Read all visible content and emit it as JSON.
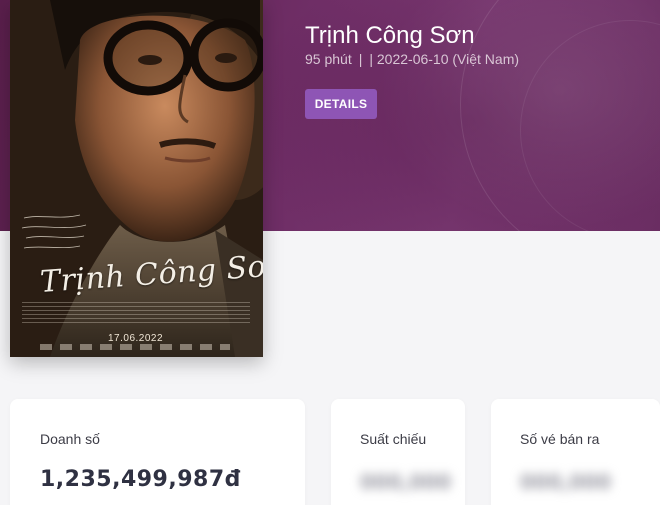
{
  "movie": {
    "title": "Trịnh Công Sơn",
    "duration": "95 phút",
    "separator": "|",
    "release": "| 2022-06-10 (Việt Nam)",
    "details_label": "DETAILS"
  },
  "poster": {
    "title_text": "Trịnh Công Sơn",
    "date_text": "17.06.2022"
  },
  "stats": {
    "revenue": {
      "label": "Doanh số",
      "value": "1,235,499,987đ"
    },
    "screenings": {
      "label": "Suất chiếu",
      "value_hidden": "000,000"
    },
    "tickets": {
      "label": "Số vé bán ra",
      "value_hidden": "000,000"
    }
  },
  "colors": {
    "hero_purple": "#6f2e66",
    "button_purple": "#8e55b5",
    "page_bg": "#f5f5f7"
  }
}
